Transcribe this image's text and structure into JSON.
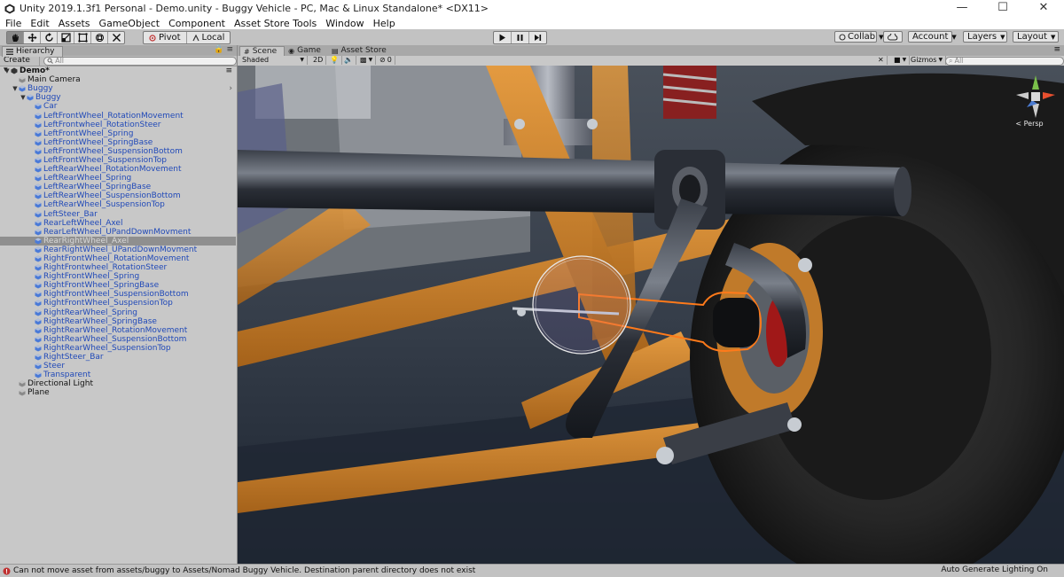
{
  "window": {
    "title": "Unity 2019.1.3f1 Personal - Demo.unity - Buggy Vehicle - PC, Mac & Linux Standalone* <DX11>",
    "minimize": "—",
    "maximize": "☐",
    "close": "✕"
  },
  "menu": [
    "File",
    "Edit",
    "Assets",
    "GameObject",
    "Component",
    "Asset Store Tools",
    "Window",
    "Help"
  ],
  "toolbar": {
    "pivot_label": "Pivot",
    "local_label": "Local",
    "collab_label": "Collab",
    "account_label": "Account",
    "layers_label": "Layers",
    "layout_label": "Layout"
  },
  "hierarchy": {
    "tab_label": "Hierarchy",
    "create_label": "Create",
    "search_placeholder": "All",
    "scene_name": "Demo*",
    "items": [
      {
        "label": "Main Camera",
        "depth": 1,
        "color": "black"
      },
      {
        "label": "Buggy",
        "depth": 1,
        "color": "blue",
        "expanded": true
      },
      {
        "label": "Buggy",
        "depth": 2,
        "color": "blue",
        "expanded": true
      },
      {
        "label": "Car",
        "depth": 3,
        "color": "blue"
      },
      {
        "label": "LeftFrontWheel_RotationMovement",
        "depth": 3,
        "color": "blue"
      },
      {
        "label": "LeftFrontwheel_RotationSteer",
        "depth": 3,
        "color": "blue"
      },
      {
        "label": "LeftFrontWheel_Spring",
        "depth": 3,
        "color": "blue"
      },
      {
        "label": "LeftFrontWheel_SpringBase",
        "depth": 3,
        "color": "blue"
      },
      {
        "label": "LeftFrontWheel_SuspensionBottom",
        "depth": 3,
        "color": "blue"
      },
      {
        "label": "LeftFrontWheel_SuspensionTop",
        "depth": 3,
        "color": "blue"
      },
      {
        "label": "LeftRearWheel_RotationMovement",
        "depth": 3,
        "color": "blue"
      },
      {
        "label": "LeftRearWheel_Spring",
        "depth": 3,
        "color": "blue"
      },
      {
        "label": "LeftRearWheel_SpringBase",
        "depth": 3,
        "color": "blue"
      },
      {
        "label": "LeftRearWheel_SuspensionBottom",
        "depth": 3,
        "color": "blue"
      },
      {
        "label": "LeftRearWheel_SuspensionTop",
        "depth": 3,
        "color": "blue"
      },
      {
        "label": "LeftSteer_Bar",
        "depth": 3,
        "color": "blue"
      },
      {
        "label": "RearLeftWheel_Axel",
        "depth": 3,
        "color": "blue"
      },
      {
        "label": "RearLeftWheel_UPandDownMovment",
        "depth": 3,
        "color": "blue"
      },
      {
        "label": "RearRightWheel_Axel",
        "depth": 3,
        "color": "blue",
        "selected": true
      },
      {
        "label": "RearRightWheel_UPandDownMovment",
        "depth": 3,
        "color": "blue"
      },
      {
        "label": "RightFrontWheel_RotationMovement",
        "depth": 3,
        "color": "blue"
      },
      {
        "label": "RightFrontwheel_RotationSteer",
        "depth": 3,
        "color": "blue"
      },
      {
        "label": "RightFrontWheel_Spring",
        "depth": 3,
        "color": "blue"
      },
      {
        "label": "RightFrontWheel_SpringBase",
        "depth": 3,
        "color": "blue"
      },
      {
        "label": "RightFrontWheel_SuspensionBottom",
        "depth": 3,
        "color": "blue"
      },
      {
        "label": "RightFrontWheel_SuspensionTop",
        "depth": 3,
        "color": "blue"
      },
      {
        "label": "RightRearWheel_Spring",
        "depth": 3,
        "color": "blue"
      },
      {
        "label": "RightRearWheel_SpringBase",
        "depth": 3,
        "color": "blue"
      },
      {
        "label": "RightRearWheel_RotationMovement",
        "depth": 3,
        "color": "blue"
      },
      {
        "label": "RightRearWheel_SuspensionBottom",
        "depth": 3,
        "color": "blue"
      },
      {
        "label": "RightRearWheel_SuspensionTop",
        "depth": 3,
        "color": "blue"
      },
      {
        "label": "RightSteer_Bar",
        "depth": 3,
        "color": "blue"
      },
      {
        "label": "Steer",
        "depth": 3,
        "color": "blue"
      },
      {
        "label": "Transparent",
        "depth": 3,
        "color": "blue"
      },
      {
        "label": "Directional Light",
        "depth": 1,
        "color": "black"
      },
      {
        "label": "Plane",
        "depth": 1,
        "color": "black"
      }
    ]
  },
  "scene": {
    "tabs": [
      {
        "label": "Scene",
        "icon": "scene-icon",
        "active": true
      },
      {
        "label": "Game",
        "icon": "game-icon",
        "active": false
      },
      {
        "label": "Asset Store",
        "icon": "asset-store-icon",
        "active": false
      }
    ],
    "shading_mode": "Shaded",
    "mode_2d": "2D",
    "effects_count": "0",
    "gizmos_label": "Gizmos",
    "search_placeholder": "All",
    "gizmo_axis_label": "< Persp"
  },
  "status": {
    "message": "Can not move asset from assets/buggy to Assets/Nomad Buggy Vehicle. Destination parent directory does not exist",
    "right_text": "Auto Generate Lighting On"
  },
  "colors": {
    "chassis_orange": "#d4872a",
    "selection_outline": "#ff7a1a",
    "hierarchy_blue": "#2049b8"
  }
}
